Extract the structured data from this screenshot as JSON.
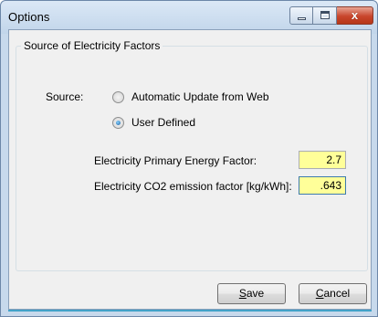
{
  "window": {
    "title": "Options"
  },
  "caption_buttons": {
    "close_glyph": "x"
  },
  "group": {
    "title": "Source of Electricity Factors"
  },
  "source": {
    "label": "Source:",
    "options": [
      {
        "label": "Automatic Update from Web",
        "selected": false
      },
      {
        "label": "User Defined",
        "selected": true
      }
    ]
  },
  "factors": {
    "primary_energy": {
      "label": "Electricity Primary Energy Factor:",
      "value": "2.7"
    },
    "co2": {
      "label": "Electricity CO2 emission factor [kg/kWh]:",
      "value": ".643"
    }
  },
  "buttons": {
    "save": {
      "mnemonic": "S",
      "rest": "ave"
    },
    "cancel": {
      "mnemonic": "C",
      "rest": "ancel"
    }
  },
  "colors": {
    "field_bg": "#ffff99",
    "accent": "#42a2c8"
  }
}
